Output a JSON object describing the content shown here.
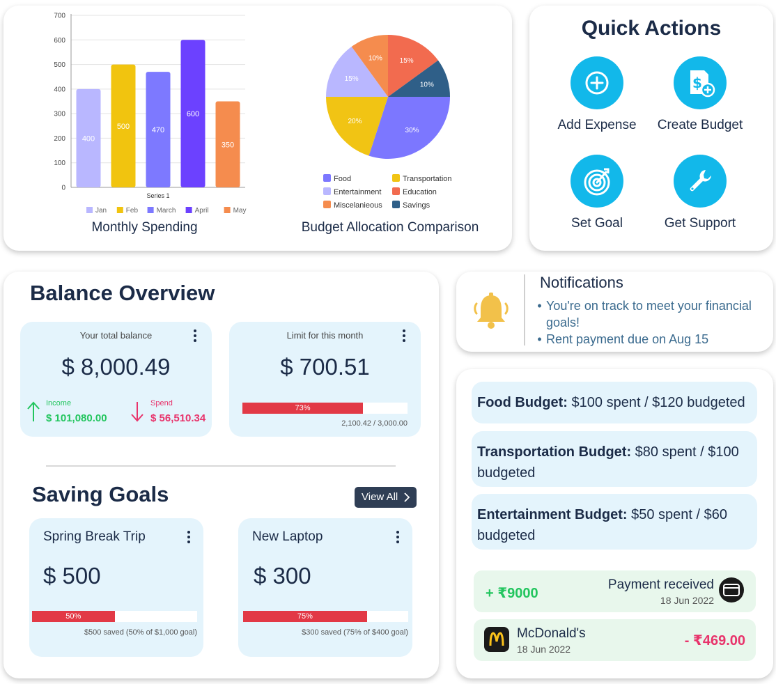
{
  "charts": {
    "monthly": {
      "caption": "Monthly Spending",
      "chart_data": {
        "type": "bar",
        "categories": [
          "Jan",
          "Feb",
          "March",
          "April",
          "May"
        ],
        "values": [
          400,
          500,
          470,
          600,
          350
        ],
        "colors": [
          "#b9b7ff",
          "#f1c40f",
          "#7d79ff",
          "#6c41ff",
          "#f58c4e"
        ],
        "xlabel": "Series 1",
        "ylim": [
          0,
          700
        ],
        "yticks": [
          0,
          100,
          200,
          300,
          400,
          500,
          600,
          700
        ],
        "legend": "bottom",
        "grid": true
      }
    },
    "allocation": {
      "caption": "Budget Allocation Comparison",
      "chart_data": {
        "type": "pie",
        "slices": [
          {
            "label": "Education",
            "value": 15,
            "color": "#f26b4f"
          },
          {
            "label": "Savings",
            "value": 10,
            "color": "#2f5f88"
          },
          {
            "label": "Food",
            "value": 30,
            "color": "#7c77ff"
          },
          {
            "label": "Transportation",
            "value": 20,
            "color": "#f1c414"
          },
          {
            "label": "Entertainment",
            "value": 15,
            "color": "#b9b7ff"
          },
          {
            "label": "Miscelanieous",
            "value": 10,
            "color": "#f58c4e"
          }
        ],
        "legend_order": [
          "Food",
          "Transportation",
          "Entertainment",
          "Education",
          "Miscelanieous",
          "Savings"
        ],
        "legend": "bottom"
      }
    }
  },
  "quick_actions": {
    "title": "Quick Actions",
    "items": [
      {
        "label": "Add Expense",
        "icon": "plus-icon"
      },
      {
        "label": "Create Budget",
        "icon": "budget-dollar-icon"
      },
      {
        "label": "Set Goal",
        "icon": "target-icon"
      },
      {
        "label": "Get Support",
        "icon": "wrench-icon"
      }
    ]
  },
  "balance": {
    "title": "Balance Overview",
    "total": {
      "label": "Your total balance",
      "amount": "$ 8,000.49",
      "income_label": "Income",
      "income_value": "$ 101,080.00",
      "spend_label": "Spend",
      "spend_value": "$ 56,510.34"
    },
    "limit": {
      "label": "Limit for this month",
      "amount": "$ 700.51",
      "progress": 0.73,
      "progress_label": "73%",
      "detail": "2,100.42 / 3,000.00"
    }
  },
  "saving_goals": {
    "title": "Saving Goals",
    "view_all": "View All",
    "goals": [
      {
        "name": "Spring Break Trip",
        "amount": "$ 500",
        "progress": 0.5,
        "progress_label": "50%",
        "detail": "$500 saved (50% of $1,000 goal)"
      },
      {
        "name": "New Laptop",
        "amount": "$ 300",
        "progress": 0.75,
        "progress_label": "75%",
        "detail": "$300 saved (75% of $400 goal)"
      }
    ]
  },
  "notifications": {
    "title": "Notifications",
    "items": [
      "You're on track to meet your financial goals!",
      "Rent payment due on Aug 15"
    ]
  },
  "budgets": [
    {
      "name": "Food Budget:",
      "detail": "$100 spent / $120 budgeted"
    },
    {
      "name": "Transportation Budget:",
      "detail": "$80 spent / $100 budgeted"
    },
    {
      "name": "Entertainment Budget:",
      "detail": "$50 spent / $60 budgeted"
    }
  ],
  "transactions": [
    {
      "amount": "+ ₹9000",
      "title": "Payment received",
      "date": "18 Jun 2022",
      "icon": "card-icon",
      "color": "#22c55e"
    },
    {
      "amount": "- ₹469.00",
      "title": "McDonald's",
      "date": "18 Jun 2022",
      "icon": "mcdonalds-logo-icon",
      "color": "#e8336b"
    }
  ],
  "colors": {
    "primary": "#1b2b47",
    "accent": "#12b8ea",
    "card_bg": "#e4f4fc",
    "progress": "#e23946",
    "income": "#22c55e",
    "spend": "#e8336b",
    "notification_text": "#3a6a8e"
  }
}
